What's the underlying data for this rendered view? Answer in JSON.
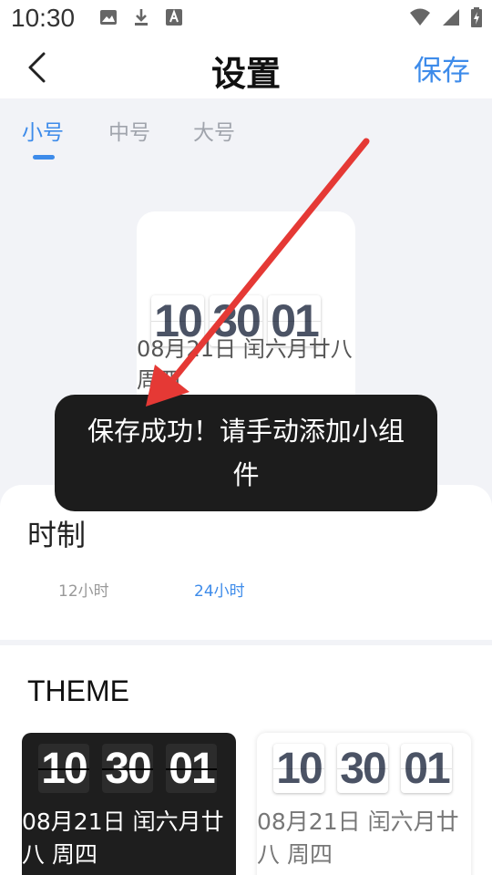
{
  "status_bar": {
    "time": "10:30",
    "left_icons": [
      "image-icon",
      "download-icon",
      "font-icon"
    ],
    "right_icons": [
      "wifi-icon",
      "signal-icon",
      "battery-charging-icon"
    ]
  },
  "header": {
    "title": "设置",
    "save_label": "保存",
    "back_icon": "chevron-left-icon"
  },
  "size_tabs": [
    {
      "label": "小号",
      "active": true
    },
    {
      "label": "中号",
      "active": false
    },
    {
      "label": "大号",
      "active": false
    }
  ],
  "preview": {
    "hours": "10",
    "minutes": "30",
    "seconds": "01",
    "date": "08月21日 闰六月廿八 周四"
  },
  "toast": {
    "message": "保存成功！请手动添加小组件"
  },
  "time_format": {
    "title": "时制",
    "options": [
      {
        "label": "12小时",
        "active": false
      },
      {
        "label": "24小时",
        "active": true
      }
    ]
  },
  "theme": {
    "title": "THEME",
    "cards": [
      {
        "style": "dark",
        "hours": "10",
        "minutes": "30",
        "seconds": "01",
        "date": "08月21日 闰六月廿八 周四"
      },
      {
        "style": "light",
        "hours": "10",
        "minutes": "30",
        "seconds": "01",
        "date": "08月21日 闰六月廿八 周四"
      }
    ]
  },
  "colors": {
    "accent": "#3d8bea",
    "annotation_arrow": "#e53935",
    "toast_bg": "#1c1c1c"
  }
}
